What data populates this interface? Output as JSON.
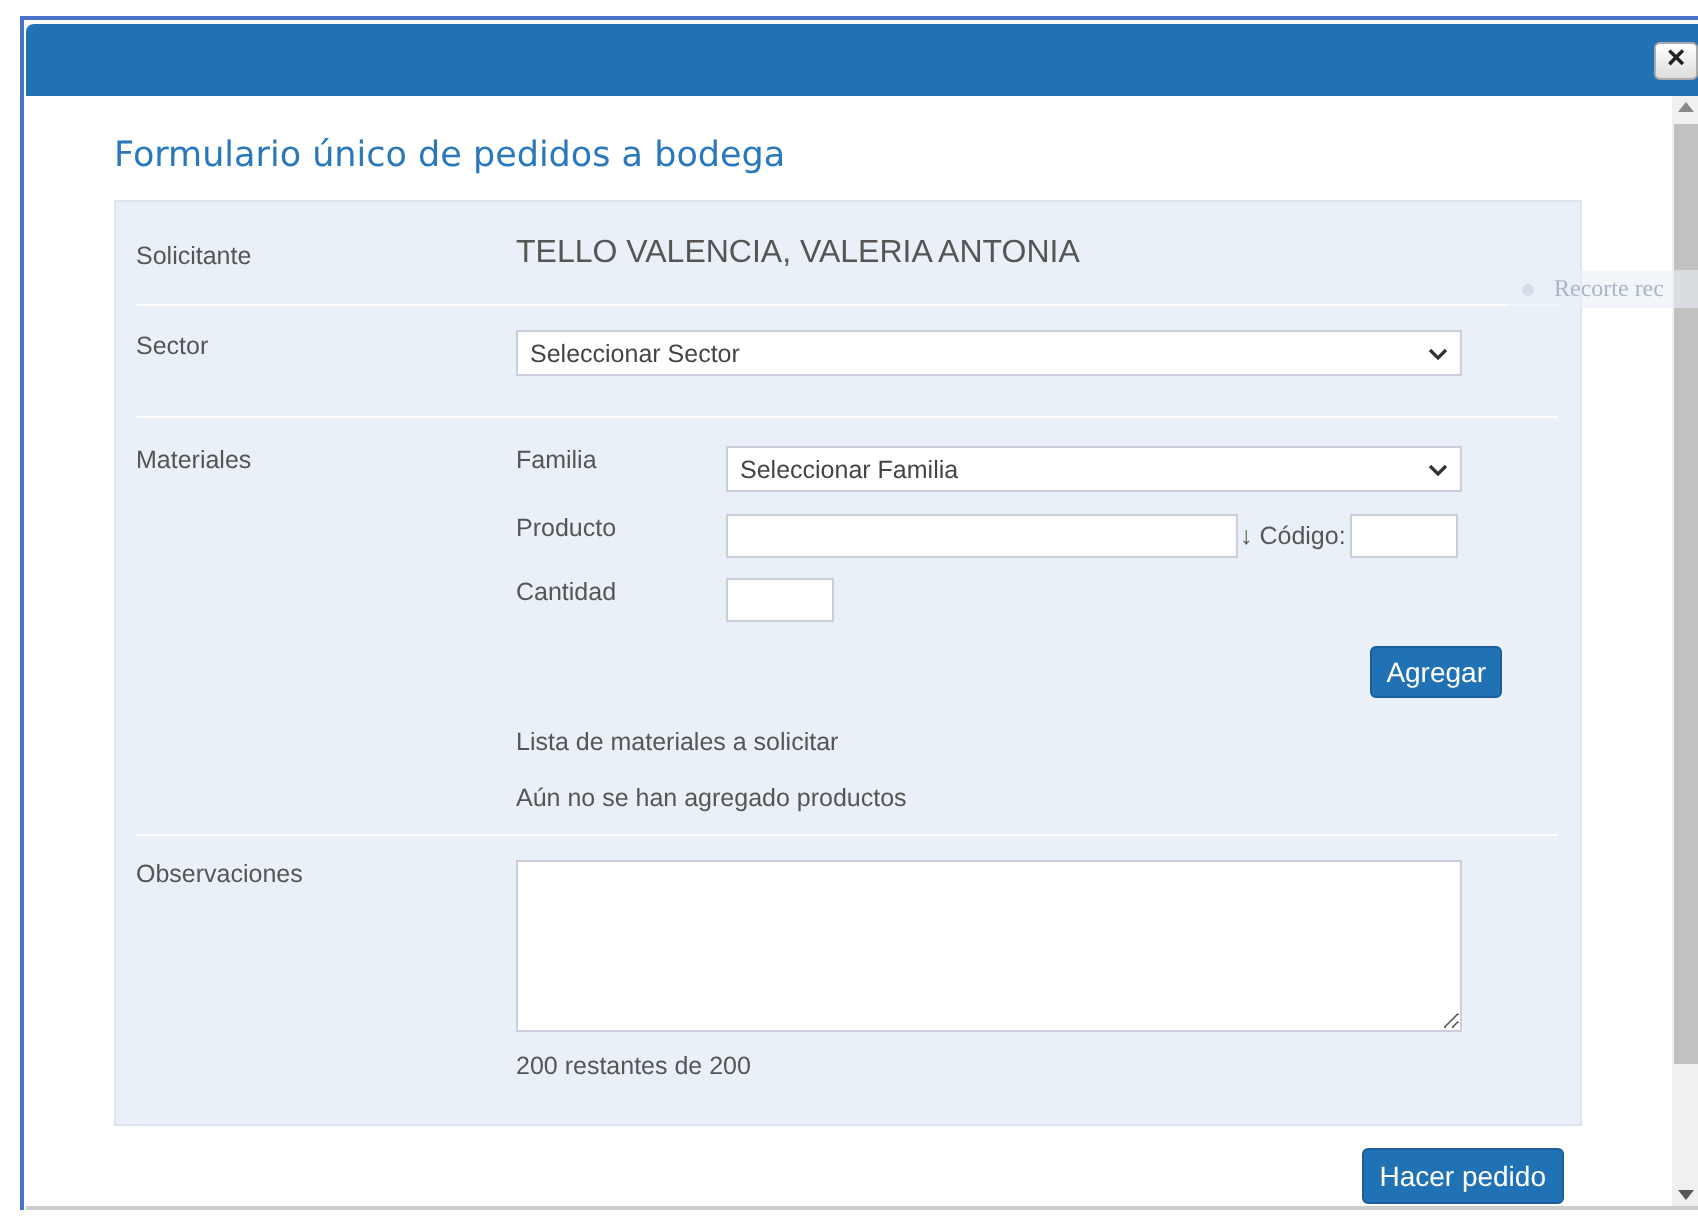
{
  "dialog": {
    "close_label": "×",
    "title": "Formulario único de pedidos a bodega"
  },
  "background_hint": "Recorte rec",
  "form": {
    "requester": {
      "label": "Solicitante",
      "value": "TELLO VALENCIA, VALERIA ANTONIA"
    },
    "sector": {
      "label": "Sector",
      "value": "Seleccionar Sector"
    },
    "materials": {
      "label": "Materiales",
      "family": {
        "label": "Familia",
        "value": "Seleccionar Familia"
      },
      "product": {
        "label": "Producto",
        "code_label": "↓ Código:"
      },
      "quantity": {
        "label": "Cantidad"
      },
      "add_button": "Agregar",
      "list_title": "Lista de materiales a solicitar",
      "empty_message": "Aún no se han agregado productos"
    },
    "notes": {
      "label": "Observaciones",
      "counter": "200 restantes de 200"
    }
  },
  "submit_button": "Hacer pedido"
}
